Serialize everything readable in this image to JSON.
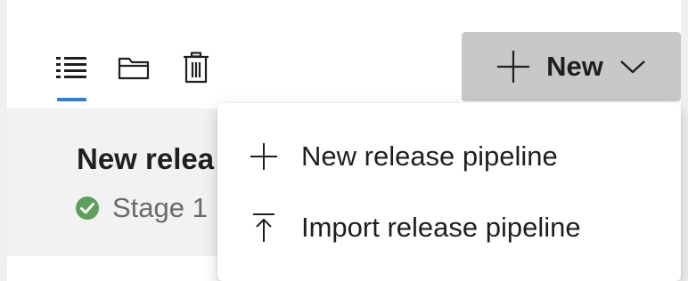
{
  "toolbar": {
    "tabs": [
      {
        "name": "list",
        "icon": "list-icon",
        "active": true
      },
      {
        "name": "folder",
        "icon": "folder-icon",
        "active": false
      },
      {
        "name": "trash",
        "icon": "trash-icon",
        "active": false
      }
    ],
    "new_button": {
      "label": "New",
      "icon": "plus-icon",
      "chevron": "chevron-down-icon"
    }
  },
  "pipeline": {
    "title": "New relea",
    "stage_label": "Stage 1",
    "stage_status": "success",
    "stage_status_color": "#5aa05a"
  },
  "dropdown_menu": {
    "items": [
      {
        "label": "New release pipeline",
        "icon": "plus-icon"
      },
      {
        "label": "Import release pipeline",
        "icon": "import-icon"
      }
    ]
  },
  "colors": {
    "accent": "#2f7fd6",
    "button_bg": "#c8c8c8",
    "panel_bg": "#f2f2f2"
  }
}
